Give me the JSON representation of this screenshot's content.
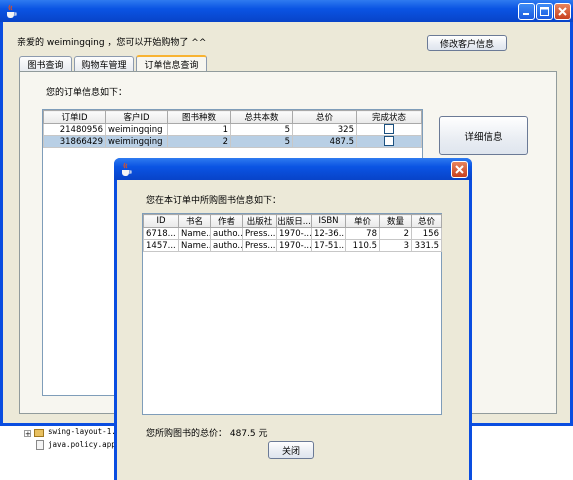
{
  "main_window": {
    "greeting": "亲爱的 weimingqing ，您可以开始购物了 ^^",
    "edit_customer_button": "修改客户信息",
    "tabs": [
      {
        "label": "图书查询"
      },
      {
        "label": "购物车管理"
      },
      {
        "label": "订单信息查询"
      }
    ],
    "orders_heading": "您的订单信息如下：",
    "orders_columns": [
      "订单ID",
      "客户ID",
      "图书种数",
      "总共本数",
      "总价",
      "完成状态"
    ],
    "orders_rows": [
      {
        "order_id": "21480956",
        "customer_id": "weimingqing",
        "kinds": "1",
        "count": "5",
        "total": "325",
        "done": false
      },
      {
        "order_id": "31866429",
        "customer_id": "weimingqing",
        "kinds": "2",
        "count": "5",
        "total": "487.5",
        "done": false
      }
    ],
    "details_button": "详细信息"
  },
  "tree": {
    "items": [
      {
        "label": "swing-layout-1..."
      },
      {
        "label": "java.policy.app..."
      }
    ]
  },
  "dialog": {
    "heading": "您在本订单中所购图书信息如下：",
    "columns": [
      "ID",
      "书名",
      "作者",
      "出版社",
      "出版日...",
      "ISBN",
      "单价",
      "数量",
      "总价"
    ],
    "rows": [
      {
        "id": "6718...",
        "name": "Name...",
        "author": "autho...",
        "publisher": "Press...",
        "date": "1970-...",
        "isbn": "12-36...",
        "price": "78",
        "qty": "2",
        "total": "156"
      },
      {
        "id": "1457...",
        "name": "Name...",
        "author": "autho...",
        "publisher": "Press...",
        "date": "1970-...",
        "isbn": "17-51...",
        "price": "110.5",
        "qty": "3",
        "total": "331.5"
      }
    ],
    "total_label": "您所购图书的总价：",
    "total_value": "487.5 元",
    "close_button": "关闭"
  },
  "colors": {
    "titlebar": "#0a54e3",
    "window_bg": "#ece9d8",
    "selected_row": "#b8cfe5",
    "close_red": "#d9533b"
  }
}
